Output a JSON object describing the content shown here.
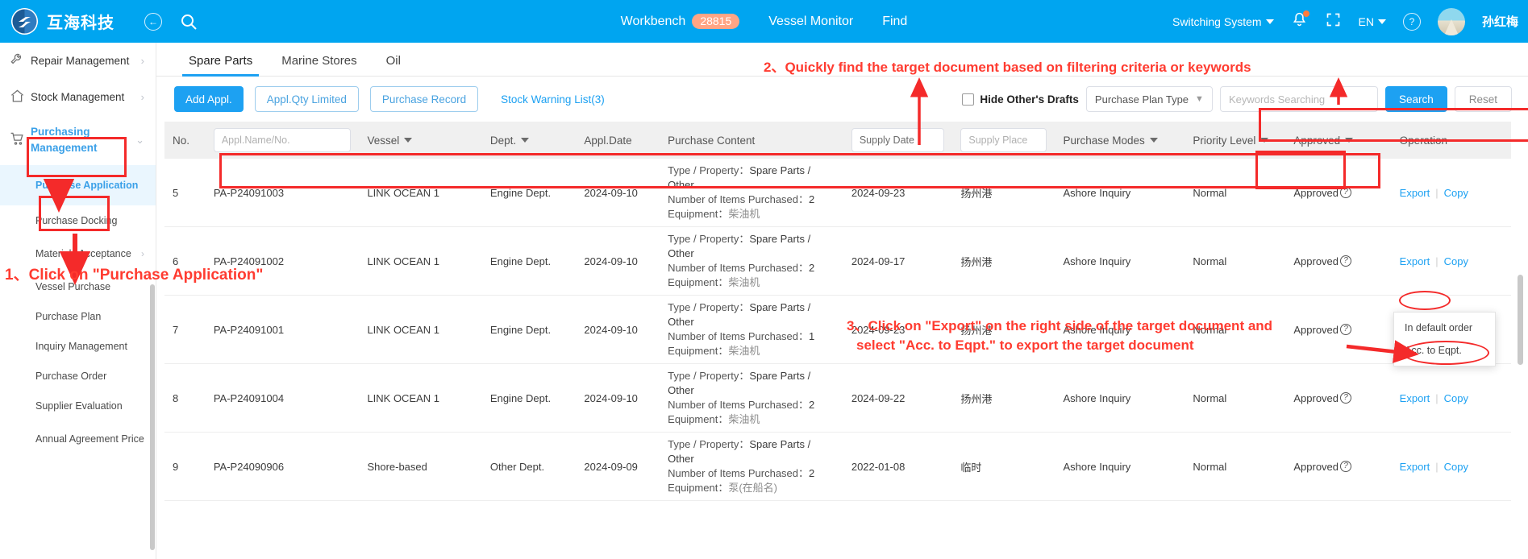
{
  "header": {
    "brand_name": "互海科技",
    "back_icon": "back-arrow-icon",
    "search_icon": "search-icon",
    "nav": [
      {
        "label": "Workbench",
        "badge": "28815"
      },
      {
        "label": "Vessel Monitor",
        "badge": ""
      },
      {
        "label": "Find",
        "badge": ""
      }
    ],
    "switch_system": "Switching System",
    "language": "EN",
    "user_name": "孙红梅"
  },
  "sidebar": {
    "items": [
      {
        "label": "Repair Management",
        "icon": "wrench-icon",
        "arrow": "›"
      },
      {
        "label": "Stock Management",
        "icon": "home-icon",
        "arrow": "›"
      },
      {
        "label": "Purchasing Management",
        "icon": "cart-icon",
        "arrow": "⌄"
      }
    ],
    "sub_items": [
      {
        "label": "Purchase Application",
        "selected": true
      },
      {
        "label": "Purchase Docking",
        "selected": false
      },
      {
        "label": "Materials Acceptance",
        "selected": false,
        "arrow": "›"
      },
      {
        "label": "Vessel Purchase",
        "selected": false
      },
      {
        "label": "Purchase Plan",
        "selected": false
      },
      {
        "label": "Inquiry Management",
        "selected": false
      },
      {
        "label": "Purchase Order",
        "selected": false
      },
      {
        "label": "Supplier Evaluation",
        "selected": false
      },
      {
        "label": "Annual Agreement Price",
        "selected": false
      }
    ]
  },
  "tabs": [
    {
      "label": "Spare Parts",
      "active": true
    },
    {
      "label": "Marine Stores",
      "active": false
    },
    {
      "label": "Oil",
      "active": false
    }
  ],
  "toolbar": {
    "add_appl": "Add Appl.",
    "appl_qty_limited": "Appl.Qty Limited",
    "purchase_record": "Purchase Record",
    "stock_warning": "Stock Warning List(3)",
    "hide_drafts_label": "Hide Other's Drafts",
    "plan_type_value": "Purchase Plan Type",
    "keywords_placeholder": "Keywords Searching",
    "search_label": "Search",
    "reset_label": "Reset"
  },
  "table": {
    "headers": {
      "no": "No.",
      "appl_name": "Appl.Name/No.",
      "vessel": "Vessel",
      "dept": "Dept.",
      "appl_date": "Appl.Date",
      "purchase_content": "Purchase Content",
      "supply_date": "Supply Date",
      "supply_place": "Supply Place",
      "purchase_modes": "Purchase Modes",
      "priority_level": "Priority Level",
      "approved": "Approved",
      "operation": "Operation"
    },
    "content_labels": {
      "type_property": "Type / Property：",
      "number_items": "Number of Items Purchased：",
      "equipment": "Equipment："
    },
    "ops": {
      "export": "Export",
      "copy": "Copy",
      "sep": "|"
    },
    "rows": [
      {
        "no": "5",
        "appl_no": "PA-P24091003",
        "vessel": "LINK OCEAN 1",
        "dept": "Engine Dept.",
        "appl_date": "2024-09-10",
        "type_property": "Spare Parts / Other",
        "items": "2",
        "equipment": "柴油机",
        "supply_date": "2024-09-23",
        "supply_place": "扬州港",
        "mode": "Ashore Inquiry",
        "priority": "Normal",
        "approved": "Approved"
      },
      {
        "no": "6",
        "appl_no": "PA-P24091002",
        "vessel": "LINK OCEAN 1",
        "dept": "Engine Dept.",
        "appl_date": "2024-09-10",
        "type_property": "Spare Parts / Other",
        "items": "2",
        "equipment": "柴油机",
        "supply_date": "2024-09-17",
        "supply_place": "扬州港",
        "mode": "Ashore Inquiry",
        "priority": "Normal",
        "approved": "Approved"
      },
      {
        "no": "7",
        "appl_no": "PA-P24091001",
        "vessel": "LINK OCEAN 1",
        "dept": "Engine Dept.",
        "appl_date": "2024-09-10",
        "type_property": "Spare Parts / Other",
        "items": "1",
        "equipment": "柴油机",
        "supply_date": "2024-09-23",
        "supply_place": "扬州港",
        "mode": "Ashore Inquiry",
        "priority": "Normal",
        "approved": "Approved"
      },
      {
        "no": "8",
        "appl_no": "PA-P24091004",
        "vessel": "LINK OCEAN 1",
        "dept": "Engine Dept.",
        "appl_date": "2024-09-10",
        "type_property": "Spare Parts / Other",
        "items": "2",
        "equipment": "柴油机",
        "supply_date": "2024-09-22",
        "supply_place": "扬州港",
        "mode": "Ashore Inquiry",
        "priority": "Normal",
        "approved": "Approved"
      },
      {
        "no": "9",
        "appl_no": "PA-P24090906",
        "vessel": "Shore-based",
        "dept": "Other Dept.",
        "appl_date": "2024-09-09",
        "type_property": "Spare Parts / Other",
        "items": "2",
        "equipment": "泵(在船名)",
        "supply_date": "2022-01-08",
        "supply_place": "临时",
        "mode": "Ashore Inquiry",
        "priority": "Normal",
        "approved": "Approved"
      }
    ]
  },
  "export_menu": {
    "items": [
      "In default order",
      "Acc. to Eqpt."
    ]
  },
  "annotations": {
    "step1": "1、Click on \"Purchase Application\"",
    "step2": "2、Quickly find the target document based on filtering criteria or keywords",
    "step3_line1": "3、Click on \"Export\" on the right side of the target document and",
    "step3_line2": "select \"Acc. to Eqpt.\" to export the target document"
  },
  "colors": {
    "brand_blue": "#00a5f0",
    "accent_blue": "#1da1f2",
    "annotation_red": "#ff3b30",
    "badge_orange": "#ffa585"
  }
}
